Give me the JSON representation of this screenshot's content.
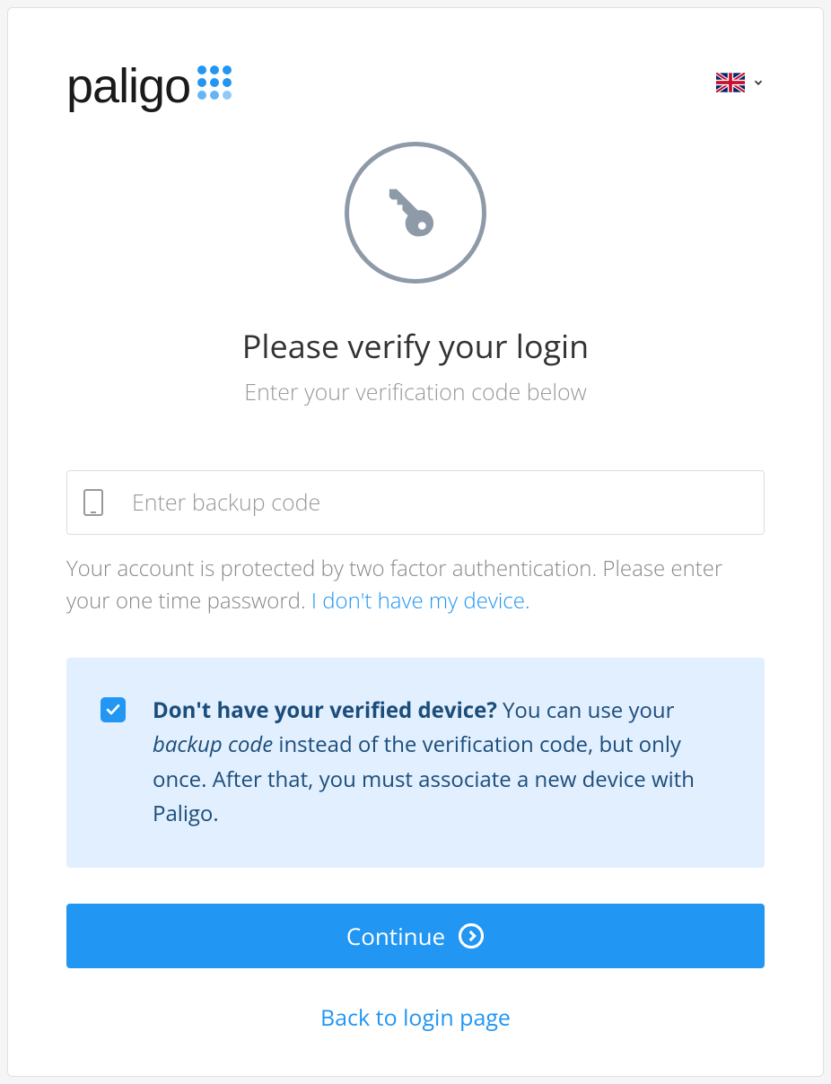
{
  "logo": {
    "text": "paligo"
  },
  "language": {
    "selected": "en-GB",
    "flag_name": "uk-flag"
  },
  "heading": {
    "title": "Please verify your login",
    "subtitle": "Enter your verification code below"
  },
  "form": {
    "code_placeholder": "Enter backup code",
    "help_text": "Your account is protected by two factor authentication. Please enter your one time password. ",
    "help_link": "I don't have my device."
  },
  "info": {
    "bold_text": "Don't have your verified device?",
    "text_part1": " You can use your ",
    "italic_text": "backup code",
    "text_part2": " instead of the verification code, but only once. After that, you must associate a new device with Paligo."
  },
  "buttons": {
    "continue": "Continue",
    "back_link": "Back to login page"
  }
}
